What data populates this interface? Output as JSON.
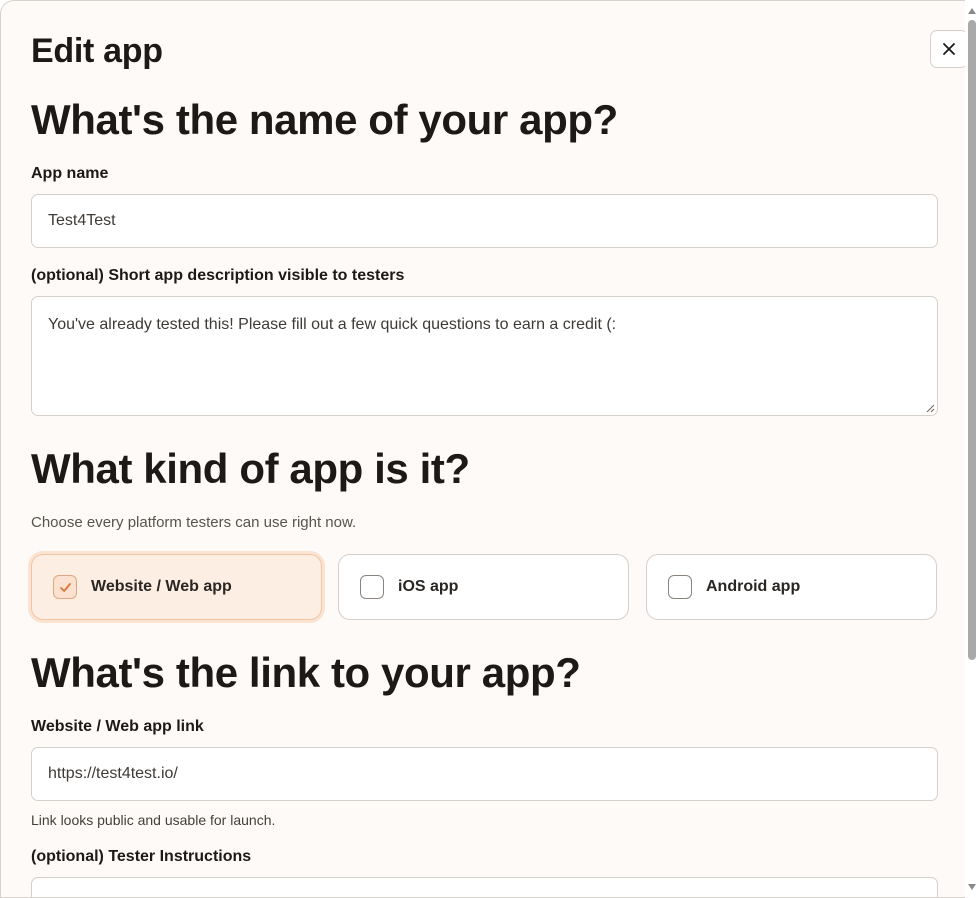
{
  "modal": {
    "title": "Edit app",
    "close_icon": "close-icon"
  },
  "name_section": {
    "heading": "What's the name of your app?",
    "app_name_label": "App name",
    "app_name_value": "Test4Test",
    "description_label": "(optional) Short app description visible to testers",
    "description_value": "You've already tested this! Please fill out a few quick questions to earn a credit (:"
  },
  "kind_section": {
    "heading": "What kind of app is it?",
    "helper": "Choose every platform testers can use right now.",
    "options": [
      {
        "label": "Website / Web app",
        "checked": true
      },
      {
        "label": "iOS app",
        "checked": false
      },
      {
        "label": "Android app",
        "checked": false
      }
    ]
  },
  "link_section": {
    "heading": "What's the link to your app?",
    "link_label": "Website / Web app link",
    "link_value": "https://test4test.io/",
    "link_helper": "Link looks public and usable for launch.",
    "instructions_label": "(optional) Tester Instructions"
  },
  "colors": {
    "background": "#fdfaf7",
    "accent_bg": "#fdeee3",
    "accent_border": "#f1c4a4",
    "check": "#d9773a"
  }
}
